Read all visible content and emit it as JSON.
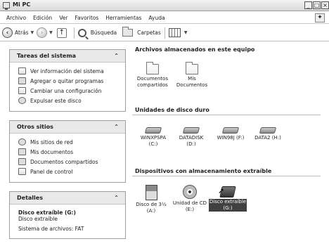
{
  "window": {
    "title": "Mi PC",
    "controls": [
      "_",
      "□",
      "×"
    ]
  },
  "menu": [
    "Archivo",
    "Edición",
    "Ver",
    "Favoritos",
    "Herramientas",
    "Ayuda"
  ],
  "toolbar": {
    "back": "Atrás",
    "search": "Búsqueda",
    "folders": "Carpetas"
  },
  "sidebar": {
    "system_tasks": {
      "title": "Tareas del sistema",
      "items": [
        "Ver información del sistema",
        "Agregar o quitar programas",
        "Cambiar una configuración",
        "Expulsar este disco"
      ]
    },
    "other_places": {
      "title": "Otros sitios",
      "items": [
        "Mis sitios de red",
        "Mis documentos",
        "Documentos compartidos",
        "Panel de control"
      ]
    },
    "details": {
      "title": "Detalles",
      "name": "Disco extraíble (G:)",
      "type": "Disco extraíble",
      "filesystem": "Sistema de archivos: FAT"
    }
  },
  "main": {
    "stored_files": {
      "title": "Archivos almacenados en este equipo",
      "items": [
        {
          "l1": "Documentos",
          "l2": "compartidos"
        },
        {
          "l1": "Mis",
          "l2": "Documentos"
        }
      ]
    },
    "hard_drives": {
      "title": "Unidades de disco duro",
      "items": [
        {
          "l1": "WINXPSPA",
          "l2": "(C:)"
        },
        {
          "l1": "DATADISK",
          "l2": "(D:)"
        },
        {
          "l1": "WIN98J (F:)",
          "l2": ""
        },
        {
          "l1": "DATA2 (H:)",
          "l2": ""
        }
      ]
    },
    "removable": {
      "title": "Dispositivos con almacenamiento extraíble",
      "items": [
        {
          "l1": "Disco de 3½",
          "l2": "(A:)"
        },
        {
          "l1": "Unidad de CD",
          "l2": "(E:)"
        },
        {
          "l1": "Disco extraíble",
          "l2": "(G:)"
        }
      ]
    }
  }
}
